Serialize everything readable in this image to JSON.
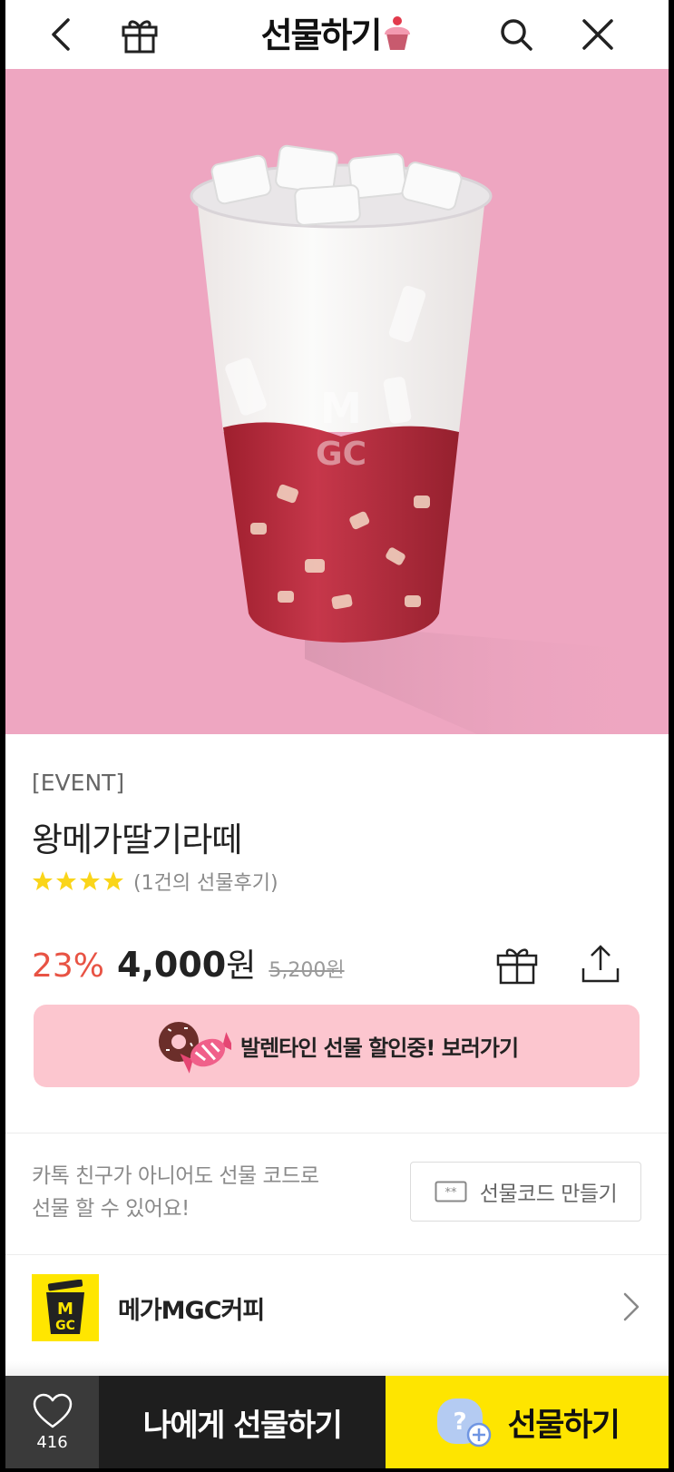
{
  "header": {
    "title": "선물하기",
    "back_icon": "chevron-left-icon",
    "gift_icon": "gift-icon",
    "search_icon": "search-icon",
    "close_icon": "close-icon"
  },
  "product": {
    "tag": "[EVENT]",
    "name": "왕메가딸기라떼",
    "rating_stars": 4,
    "review_text": "(1건의 선물후기)",
    "discount": "23%",
    "price": "4,000",
    "price_unit": "원",
    "original_price": "5,200원"
  },
  "banner": {
    "text": "발렌타인 선물 할인중! 보러가기",
    "color": "#fcc6cf"
  },
  "gift_code": {
    "desc_line1": "카톡 친구가 아니어도 선물 코드로",
    "desc_line2": "선물 할 수 있어요!",
    "button_label": "선물코드 만들기"
  },
  "brand": {
    "name": "메가MGC커피",
    "logo_text": "MGC",
    "logo_color": "#ffe600"
  },
  "bottom_bar": {
    "like_count": "416",
    "gift_me_label": "나에게 선물하기",
    "gift_label": "선물하기",
    "accent": "#fee500"
  }
}
